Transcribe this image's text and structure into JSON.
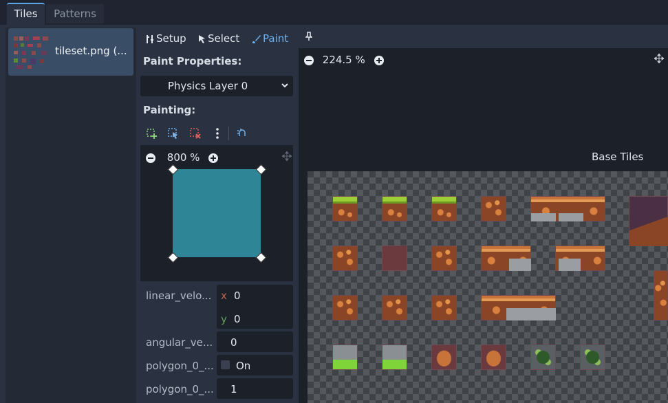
{
  "tabs": {
    "tiles": "Tiles",
    "patterns": "Patterns"
  },
  "tileset": {
    "name": "tileset.png (..."
  },
  "toolbar": {
    "setup": "Setup",
    "select": "Select",
    "paint": "Paint"
  },
  "paint_properties": {
    "title": "Paint Properties:",
    "layer": "Physics Layer 0"
  },
  "painting": {
    "title": "Painting:",
    "zoom": "800 %",
    "polygon_color": "#2e8595"
  },
  "properties": [
    {
      "label": "linear_velo...",
      "x": "0",
      "y": "0"
    },
    {
      "label": "angular_ve...",
      "value": "0"
    },
    {
      "label": "polygon_0_...",
      "value": "On"
    },
    {
      "label": "polygon_0_...",
      "value": "1"
    }
  ],
  "axes": {
    "x": "x",
    "y": "y"
  },
  "canvas": {
    "zoom": "224.5 %",
    "base_tiles_label": "Base Tiles"
  },
  "colors": {
    "accent": "#5aa6e8",
    "axis_x": "#c0604a",
    "axis_y": "#5fa05a"
  }
}
